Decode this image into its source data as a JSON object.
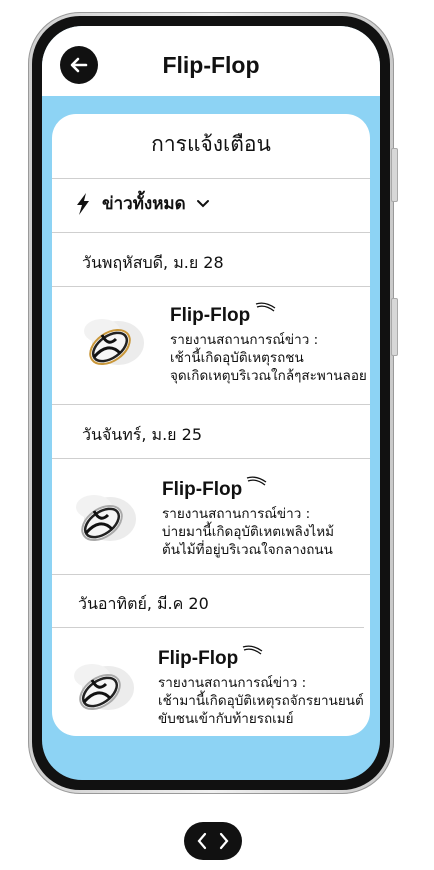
{
  "app": {
    "title": "Flip-Flop"
  },
  "card": {
    "title": "การแจ้งเตือน",
    "filter_label": "ข่าวทั้งหมด"
  },
  "groups": [
    {
      "date": "วันพฤหัสบดี, ม.ย 28",
      "item": {
        "title": "Flip-Flop",
        "line1": "รายงานสถานการณ์ข่าว :",
        "line2": "เช้านี้เกิดอุบัติเหตุรถชน",
        "line3": "จุดเกิดเหตุบริเวณใกล้ๆสะพานลอย"
      }
    },
    {
      "date": "วันจันทร์, ม.ย 25",
      "item": {
        "title": "Flip-Flop",
        "line1": "รายงานสถานการณ์ข่าว :",
        "line2": "บ่ายมานี้เกิดอุบัติเหตเพลิงไหม้",
        "line3": "ต้นไม้ที่อยู่บริเวณใจกลางถนน"
      }
    },
    {
      "date": "วันอาทิตย์, มี.ค 20",
      "item": {
        "title": "Flip-Flop",
        "line1": "รายงานสถานการณ์ข่าว :",
        "line2": "เช้ามานี้เกิดอุบัติเหตุรถจักรยานยนต์",
        "line3": "ขับชนเข้ากับท้ายรถเมย์"
      }
    }
  ],
  "icons": {
    "back": "arrow-left-icon",
    "filter": "lightning-icon",
    "dropdown": "chevron-down-icon",
    "thumb": "flip-flop-sandal-icon",
    "nav_prev": "chevron-left-icon",
    "nav_next": "chevron-right-icon"
  },
  "colors": {
    "accent": "#8dd3f4",
    "dark": "#111111"
  }
}
